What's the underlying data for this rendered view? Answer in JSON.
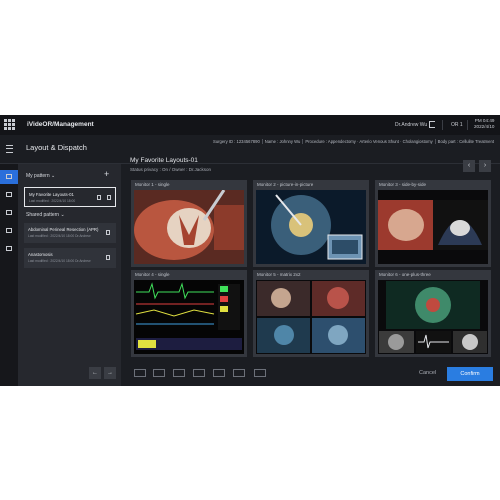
{
  "app": {
    "name": "iVideOR/Management",
    "user_name": "Dr.Andrew Wu",
    "room": "OR 1",
    "time": "PM 04:49",
    "date": "2022/4/10"
  },
  "header": {
    "title": "Layout & Dispatch",
    "surgery_info": [
      "Surgery ID : 1234567890",
      "Name : Johnny Wu",
      "Procedure : Appendectomy · Arterio Venous Shunt · Cholangiostomy",
      "Body part : Cellulite Treatment"
    ]
  },
  "sidebar": {
    "my_pattern_label": "My pattern",
    "add_label": "+",
    "my_patterns": [
      {
        "name": "My Favorite Layouts-01",
        "meta": "Last modified : 2022/4/10 18:00"
      }
    ],
    "shared_pattern_label": "Shared pattern",
    "shared_patterns": [
      {
        "name": "Abdominal Perineal Resection (APR)",
        "meta": "Last modified : 2022/4/10 18:00 Dr.Andrew"
      },
      {
        "name": "Anastomosis",
        "meta": "Last modified : 2022/4/10 18:00 Dr.Andrew"
      }
    ]
  },
  "main": {
    "title": "My Favorite Layouts-01",
    "status": "Status privacy : On / Owner : Dr.Jackson",
    "monitors": [
      {
        "label": "Monitor 1 - single"
      },
      {
        "label": "Monitor 2 - picture-in-picture"
      },
      {
        "label": "Monitor 3 - side-by-side"
      },
      {
        "label": "Monitor 4 - single"
      },
      {
        "label": "Monitor 5 - matrix 2x2"
      },
      {
        "label": "Monitor 6 - one-plus-three"
      }
    ],
    "cancel_label": "Cancel",
    "confirm_label": "Confirm"
  },
  "colors": {
    "accent": "#2a7de1",
    "background": "#1b1d22",
    "sidebar": "#26282e"
  }
}
